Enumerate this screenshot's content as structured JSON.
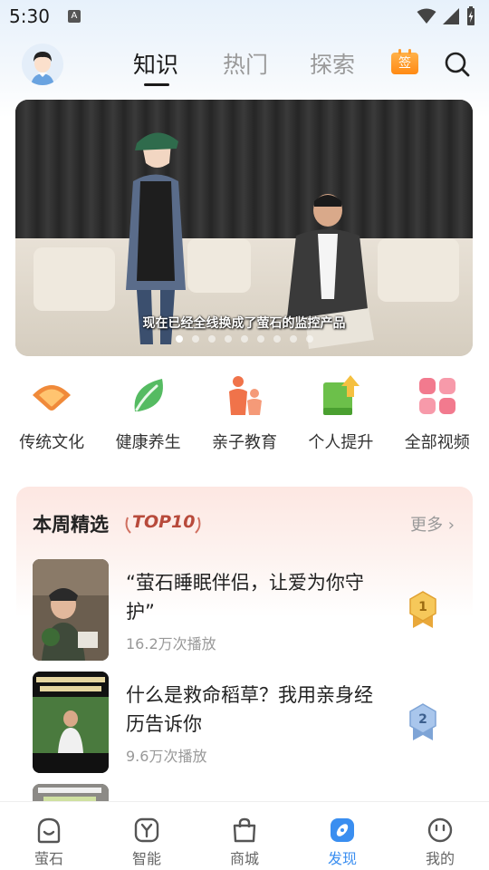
{
  "status_bar": {
    "time": "5:30",
    "notif_icon": "A"
  },
  "header": {
    "tabs": [
      {
        "label": "知识",
        "active": true
      },
      {
        "label": "热门",
        "active": false
      },
      {
        "label": "探索",
        "active": false
      }
    ],
    "sign_in_label": "签",
    "icons": [
      "avatar",
      "sign-in-calendar-icon",
      "search-icon"
    ]
  },
  "banner": {
    "caption": "现在已经全线换成了萤石的监控产品",
    "dot_count": 9,
    "active_dot": 0
  },
  "categories": [
    {
      "label": "传统文化",
      "icon": "fan-icon",
      "color": "#f07a3a"
    },
    {
      "label": "健康养生",
      "icon": "leaf-icon",
      "color": "#4cb45a"
    },
    {
      "label": "亲子教育",
      "icon": "parent-child-icon",
      "color": "#f0734a"
    },
    {
      "label": "个人提升",
      "icon": "book-up-icon",
      "color": "#6cc04a"
    },
    {
      "label": "全部视频",
      "icon": "grid-icon",
      "color": "#f07a8a"
    }
  ],
  "weekly": {
    "title": "本周精选",
    "badge": "TOP10",
    "more_label": "更多",
    "items": [
      {
        "title": "“萤石睡眠伴侣，让爱为你守护”",
        "plays": "16.2万次播放",
        "rank": "1",
        "rank_color": "#f2b84a"
      },
      {
        "title": "什么是救命稻草？我用亲身经历告诉你",
        "plays": "9.6万次播放",
        "rank": "2",
        "rank_color": "#8fb3e0"
      }
    ]
  },
  "bottom_nav": [
    {
      "label": "萤石",
      "icon": "home-face-icon",
      "active": false
    },
    {
      "label": "智能",
      "icon": "smart-y-icon",
      "active": false
    },
    {
      "label": "商城",
      "icon": "shopping-bag-icon",
      "active": false
    },
    {
      "label": "发现",
      "icon": "discover-icon",
      "active": true
    },
    {
      "label": "我的",
      "icon": "profile-face-icon",
      "active": false
    }
  ],
  "colors": {
    "accent": "#3a8ef0",
    "sign_badge": "#ff9a2a"
  }
}
